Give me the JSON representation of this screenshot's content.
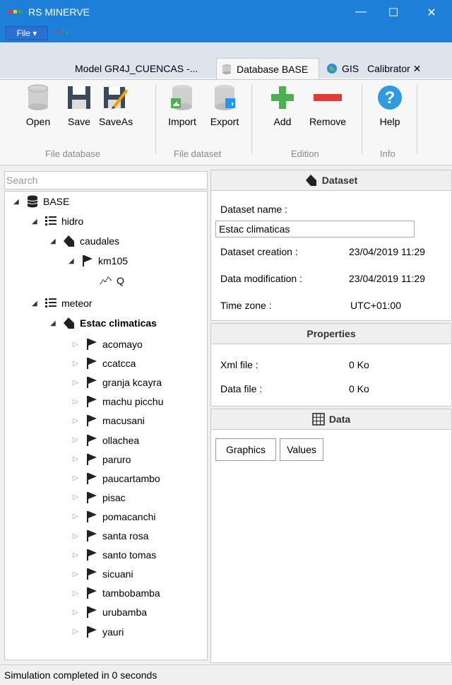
{
  "window": {
    "title": "RS MINERVE",
    "minimize": "—",
    "maximize": "☐",
    "close": "✕"
  },
  "menu": {
    "file_label": "File ▾"
  },
  "tabs": [
    {
      "label": "Model GR4J_CUENCAS -..."
    },
    {
      "label": "Database BASE"
    },
    {
      "label": "GIS"
    },
    {
      "label": "Calibrator ✕"
    }
  ],
  "ribbon": {
    "buttons": [
      {
        "label": "Open"
      },
      {
        "label": "Save"
      },
      {
        "label": "SaveAs"
      },
      {
        "label": "Import"
      },
      {
        "label": "Export"
      },
      {
        "label": "Add"
      },
      {
        "label": "Remove"
      },
      {
        "label": "Help"
      }
    ],
    "groups": [
      {
        "label": "File database"
      },
      {
        "label": "File dataset"
      },
      {
        "label": "Edition"
      },
      {
        "label": "Info"
      }
    ]
  },
  "search": {
    "placeholder": "Search"
  },
  "tree": {
    "base": "BASE",
    "hidro": "hidro",
    "caudales": "caudales",
    "km105": "km105",
    "q": "Q",
    "meteor": "meteor",
    "estac": "Estac climaticas",
    "stations": [
      "acomayo",
      "ccatcca",
      "granja kcayra",
      "machu picchu",
      "macusani",
      "ollachea",
      "paruro",
      "paucartambo",
      "pisac",
      "pomacanchi",
      "santa rosa",
      "santo tomas",
      "sicuani",
      "tambobamba",
      "urubamba",
      "yauri"
    ]
  },
  "dataset": {
    "header": "Dataset",
    "name_label": "Dataset name :",
    "name_value": "Estac climaticas",
    "creation_label": "Dataset creation :",
    "creation_value": "23/04/2019 11:29",
    "modification_label": "Data modification :",
    "modification_value": "23/04/2019 11:29",
    "timezone_label": "Time zone :",
    "timezone_value": "UTC+01:00"
  },
  "properties": {
    "header": "Properties",
    "xml_label": "Xml file :",
    "xml_value": "0  Ko",
    "data_label": "Data file :",
    "data_value": "0  Ko"
  },
  "data_section": {
    "header": "Data",
    "graphics_button": "Graphics",
    "values_button": "Values"
  },
  "status": {
    "text": "Simulation completed in 0 seconds"
  }
}
